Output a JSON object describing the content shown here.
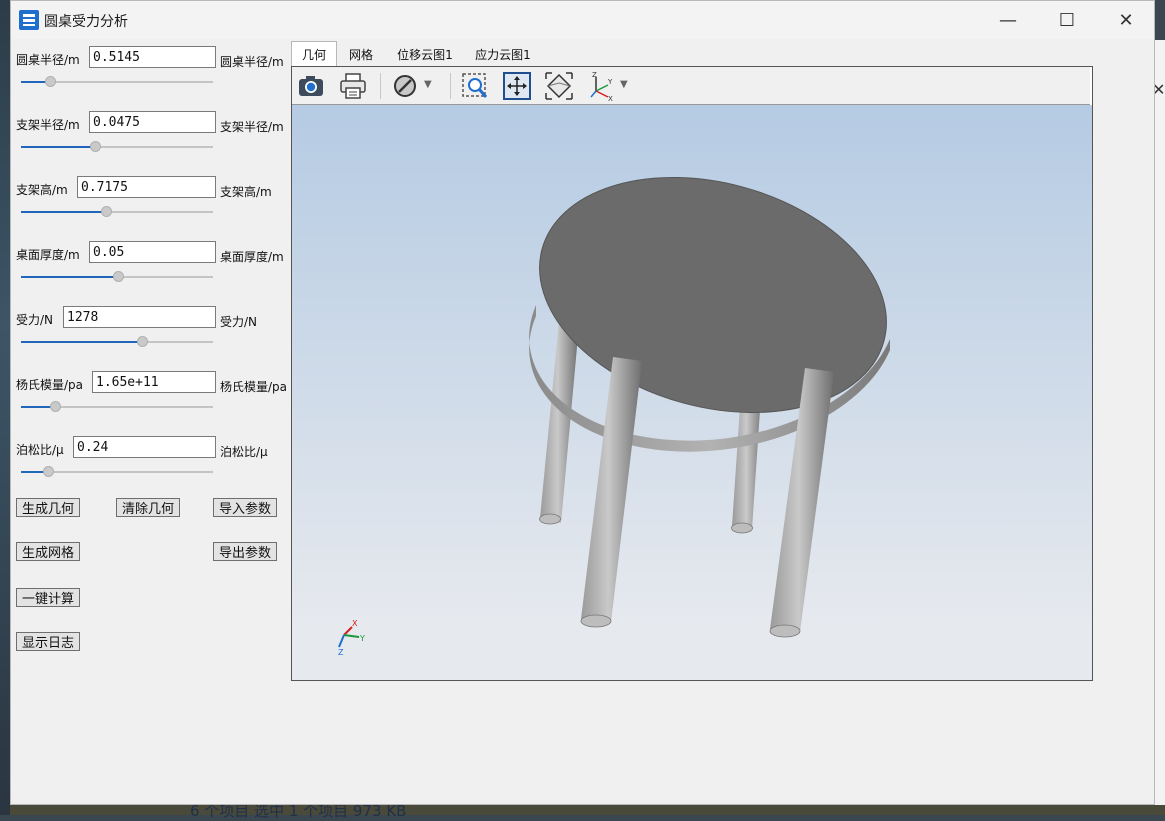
{
  "window": {
    "title": "圆桌受力分析",
    "minimize_glyph": "—",
    "maximize_glyph": "☐",
    "close_glyph": "✕",
    "accent": "#1f6fcf"
  },
  "params": [
    {
      "label": "圆桌半径/m",
      "value": "0.5145",
      "unit": "圆桌半径/m",
      "slider_fraction": 0.13
    },
    {
      "label": "支架半径/m",
      "value": "0.0475",
      "unit": "支架半径/m",
      "slider_fraction": 0.38
    },
    {
      "label": "支架高/m",
      "value": "0.7175",
      "unit": "支架高/m",
      "slider_fraction": 0.44
    },
    {
      "label": "桌面厚度/m",
      "value": "0.05",
      "unit": "桌面厚度/m",
      "slider_fraction": 0.51
    },
    {
      "label": "受力/N",
      "value": "1278",
      "unit": "受力/N",
      "slider_fraction": 0.64
    },
    {
      "label": "杨氏模量/pa",
      "value": "1.65e+11",
      "unit": "杨氏模量/pa",
      "slider_fraction": 0.16
    },
    {
      "label": "泊松比/μ",
      "value": "0.24",
      "unit": "泊松比/μ",
      "slider_fraction": 0.12
    }
  ],
  "buttons": {
    "generate_geometry": "生成几何",
    "clear_geometry": "清除几何",
    "import_params": "导入参数",
    "generate_mesh": "生成网格",
    "export_params": "导出参数",
    "one_click_compute": "一键计算",
    "show_log": "显示日志"
  },
  "tabs": [
    "几何",
    "网格",
    "位移云图1",
    "应力云图1"
  ],
  "active_tab": 0,
  "toolbar_icons": [
    "camera-icon",
    "printer-icon",
    "clip-icon",
    "zoom-box-icon",
    "fit-all-icon",
    "view-direction-icon",
    "axes-icon"
  ],
  "axes_labels": {
    "x": "X",
    "y": "Y",
    "z": "Z"
  },
  "desktop_status": "6 个项目    选中 1 个项目  973 KB"
}
